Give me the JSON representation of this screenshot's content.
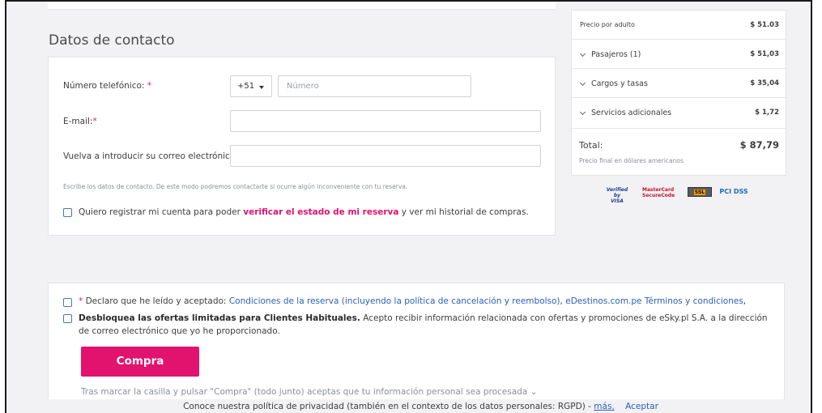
{
  "contact": {
    "title": "Datos de contacto",
    "phone_label": "Número telefónico:",
    "required_mark": "*",
    "phone_prefix": "+51",
    "phone_placeholder": "Número",
    "email_label": "E-mail:",
    "email_confirm_label": "Vuelva a introducir su correo electrónico:",
    "hint": "Escribe los datos de contacto. De este modo podremos contactarte si ocurre algún inconveniente con tu reserva.",
    "register_prefix": "Quiero registrar mi cuenta para poder",
    "register_link": "verificar el estado de mi reserva",
    "register_suffix": "y ver mi historial de compras."
  },
  "summary": {
    "price_per_adult_label": "Precio por adulto",
    "price_per_adult_value": "$ 51.03",
    "rows": [
      {
        "label": "Pasajeros (1)",
        "value": "$ 51,03"
      },
      {
        "label": "Cargos y tasas",
        "value": "$ 35,04"
      },
      {
        "label": "Servicios adicionales",
        "value": "$ 1,72"
      }
    ],
    "total_label": "Total:",
    "total_value": "$ 87,79",
    "total_note": "Precio final en dólares americanos"
  },
  "payment_logos": {
    "visa_line1": "Verified by",
    "visa_line2": "VISA",
    "mc_line1": "MasterCard",
    "mc_line2": "SecureCode",
    "ssl": "SSL",
    "pci": "PCI DSS"
  },
  "consent": {
    "terms_prefix": "Declaro que he leído y aceptado:",
    "terms_link1": "Condiciones de la reserva (incluyendo la política de cancelación y reembolso)",
    "terms_sep": ", ",
    "terms_link2": "eDestinos.com.pe Términos y condiciones",
    "terms_end": ",",
    "offers_bold": "Desbloquea las ofertas limitadas para Clientes Habituales.",
    "offers_text": "Acepto recibir información relacionada con ofertas y promociones de eSky.pl S.A. a la dirección de correo electrónico que yo he proporcionado.",
    "buy_label": "Compra",
    "processing_text": "Tras marcar la casilla y pulsar \"Compra\" (todo junto) aceptas que tu información personal sea procesada ⌄"
  },
  "cookie": {
    "text": "Conoce nuestra política de privacidad (también en el contexto de los datos personales: RGPD) -",
    "more": "más.",
    "accept": "Aceptar"
  }
}
